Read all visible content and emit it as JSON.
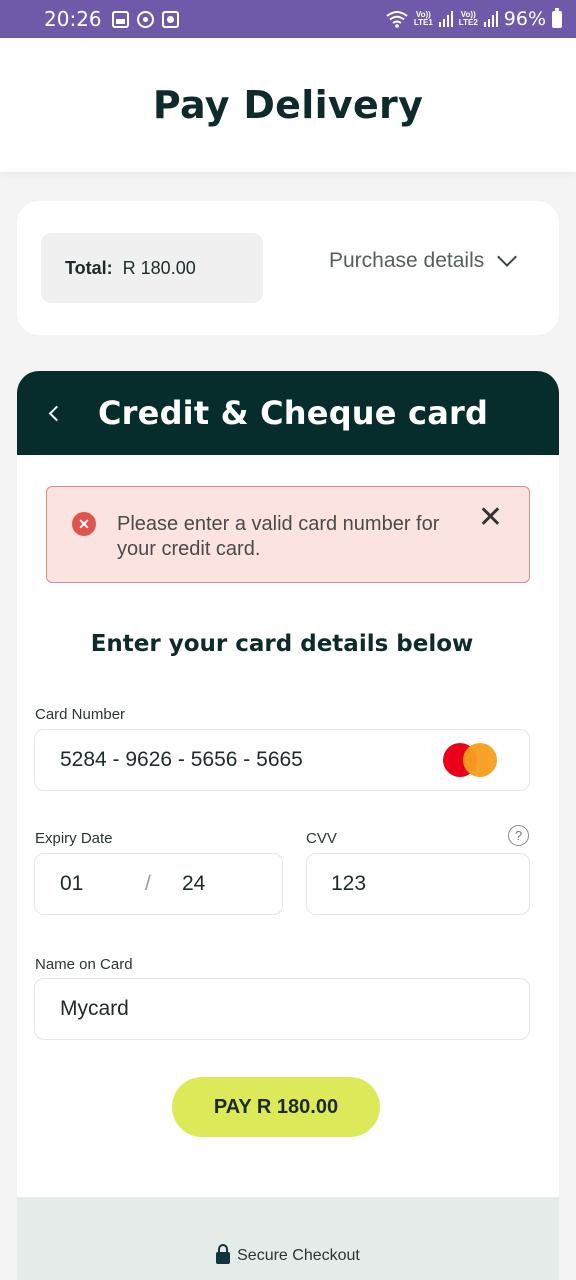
{
  "status_bar": {
    "time": "20:26",
    "sim1": "Vo))\nLTE1",
    "sim2": "Vo))\nLTE2",
    "battery": "96%"
  },
  "header": {
    "title": "Pay Delivery"
  },
  "summary": {
    "total_label": "Total:",
    "total_value": "R 180.00",
    "purchase_details": "Purchase details"
  },
  "payment": {
    "title": "Credit & Cheque card",
    "error_message": "Please enter a valid card number for your credit card.",
    "section_title": "Enter your card details below",
    "card_number_label": "Card Number",
    "card_number": "5284 - 9626 - 5656 - 5665",
    "card_brand": "mastercard-icon",
    "expiry_label": "Expiry Date",
    "expiry_month": "01",
    "expiry_separator": "/",
    "expiry_year": "24",
    "cvv_label": "CVV",
    "cvv": "123",
    "help_symbol": "?",
    "name_label": "Name on Card",
    "name": "Mycard",
    "pay_button": "PAY R 180.00",
    "secure_label": "Secure Checkout"
  },
  "colors": {
    "status_bar": "#6e5aa8",
    "panel_header": "#062c2b",
    "pay_button": "#dcea5a",
    "alert_bg": "#fbe3e0",
    "alert_border": "#e08a84"
  }
}
